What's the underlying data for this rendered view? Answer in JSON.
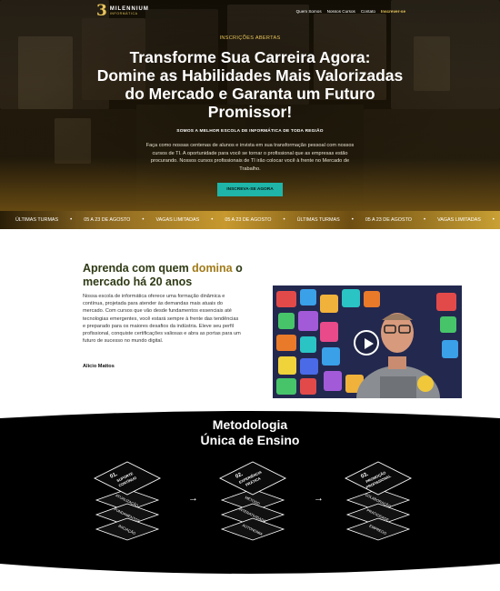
{
  "brand": {
    "logo_mark": "3",
    "name": "MILENNIUM",
    "tagline": "INFORMÁTICA"
  },
  "nav": {
    "items": [
      "Quem Somos",
      "Nossos Cursos",
      "Contato"
    ],
    "cta": "Inscrever-se"
  },
  "hero": {
    "tag": "INSCRIÇÕES ABERTAS",
    "title_line1": "Transforme Sua Carreira Agora:",
    "title_rest": "Domine as Habilidades Mais Valorizadas do Mercado e Garanta um Futuro Promissor!",
    "subtitle": "SOMOS A MELHOR ESCOLA DE INFORMÁTICA DE TODA REGIÃO",
    "description": "Faça como nossas centenas de alunos e invista em sua transformação pessoal com nossos cursos de TI. A oportunidade para você se tornar o profissional que as empresas estão procurando. Nossos cursos profissionais de TI irão colocar você à frente no Mercado de Trabalho.",
    "button": "INSCREVA-SE AGORA"
  },
  "ticker": {
    "items": [
      "ÚLTIMAS TURMAS",
      "05 A 23 DE AGOSTO",
      "VAGAS LIMITADAS",
      "05 A 23 DE AGOSTO",
      "ÚLTIMAS TURMAS",
      "05 A 23 DE AGOSTO",
      "VAGAS LIMITADAS",
      "05 A 23 DE AGOSTO"
    ]
  },
  "about": {
    "title_part1": "Aprenda com quem",
    "title_highlight": "domina",
    "title_part2": "o mercado há 20 anos",
    "text": "Nossa escola de informática oferece uma formação dinâmica e contínua, projetada para atender às demandas mais atuais do mercado. Com cursos que vão desde fundamentos essenciais até tecnologias emergentes, você estará sempre à frente das tendências e preparado para os maiores desafios da indústria. Eleve seu perfil profissional, conquiste certificações valiosas e abra as portas para um futuro de sucesso no mundo digital.",
    "author": "Alicio Mattos"
  },
  "method": {
    "title_line1": "Metodologia",
    "title_line2": "Única de Ensino",
    "steps": [
      {
        "number": "01.",
        "title": "SUPORTE CONTÍNUO",
        "layers": [
          "INICIAÇÃO",
          "FUNDAMENTOS",
          "ATUALIZAÇÃO"
        ]
      },
      {
        "number": "02.",
        "title": "EXPERIÊNCIA PRÁTICA",
        "layers": [
          "AUTONOMIA",
          "INTERATIVIDADE",
          "MÉTODO"
        ]
      },
      {
        "number": "03.",
        "title": "PROMOÇÃO PROFISSIONAL",
        "layers": [
          "EMPREGO",
          "PRATICIDADE",
          "COLABORAÇÃO"
        ]
      }
    ]
  },
  "colors": {
    "gold": "#e8c55a",
    "teal_button": "#1fb5a8",
    "about_title": "#2e3a14",
    "about_highlight": "#a07a18",
    "method_bg": "#000000"
  }
}
